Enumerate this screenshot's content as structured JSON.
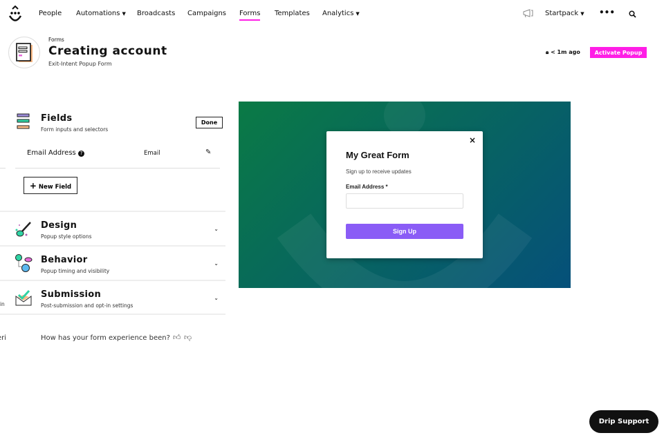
{
  "nav": {
    "items": [
      "People",
      "Automations",
      "Broadcasts",
      "Campaigns",
      "Forms",
      "Templates",
      "Analytics"
    ],
    "account": "Startpack",
    "active": "Forms"
  },
  "header": {
    "breadcrumb": "Forms",
    "title": "Creating account",
    "subtitle": "Exit-Intent Popup Form",
    "saved": "< 1m ago",
    "activate": "Activate Popup"
  },
  "fields": {
    "title": "Fields",
    "subtitle": "Form inputs and selectors",
    "done": "Done",
    "field_label": "Email Address",
    "field_type": "Email",
    "new_field": "New Field"
  },
  "sections": [
    {
      "title": "Design",
      "subtitle": "Popup style options"
    },
    {
      "title": "Behavior",
      "subtitle": "Popup timing and visibility"
    },
    {
      "title": "Submission",
      "subtitle": "Post-submission and opt-in settings"
    }
  ],
  "left_cut": {
    "a": "tin",
    "b": "eri"
  },
  "feedback": "How has your form experience been?",
  "popup": {
    "title": "My Great Form",
    "subtitle": "Sign up to receive updates",
    "email_label": "Email Address *",
    "email_value": "",
    "button": "Sign Up"
  },
  "support": "Drip Support",
  "colors": {
    "accent": "#ff1ee6",
    "button": "#8a5cf6",
    "bg_from": "#0a7a45",
    "bg_to": "#05507a"
  }
}
